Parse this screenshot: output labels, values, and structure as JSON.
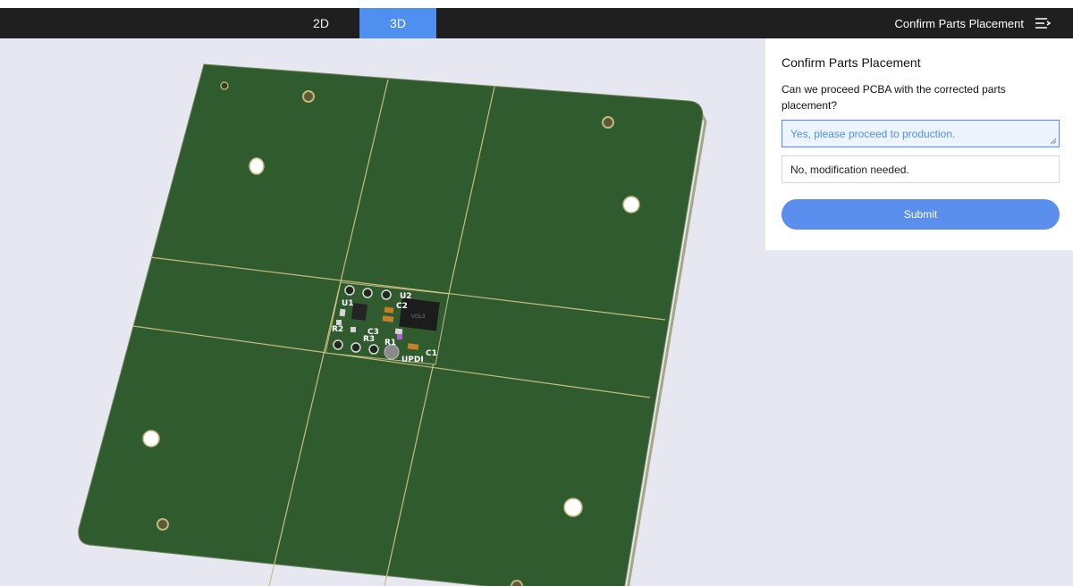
{
  "tabs": {
    "tab_2d": "2D",
    "tab_3d": "3D",
    "active": "3D"
  },
  "header": {
    "title": "Confirm Parts Placement",
    "menu_icon": "list-menu-icon"
  },
  "panel": {
    "title": "Confirm Parts Placement",
    "question": "Can we proceed PCBA with the corrected parts placement?",
    "options": [
      {
        "label": "Yes, please proceed to production.",
        "selected": true
      },
      {
        "label": "No, modification needed.",
        "selected": false
      }
    ],
    "submit_label": "Submit"
  },
  "board": {
    "labels": [
      "U1",
      "U2",
      "C2",
      "R2",
      "C3",
      "R3",
      "R1",
      "C1",
      "UPDI"
    ],
    "chip_marking": "VGL3",
    "colors": {
      "board": "#2f5b2f",
      "edge": "#b6a96e",
      "accent": "#4f8ff0"
    }
  }
}
